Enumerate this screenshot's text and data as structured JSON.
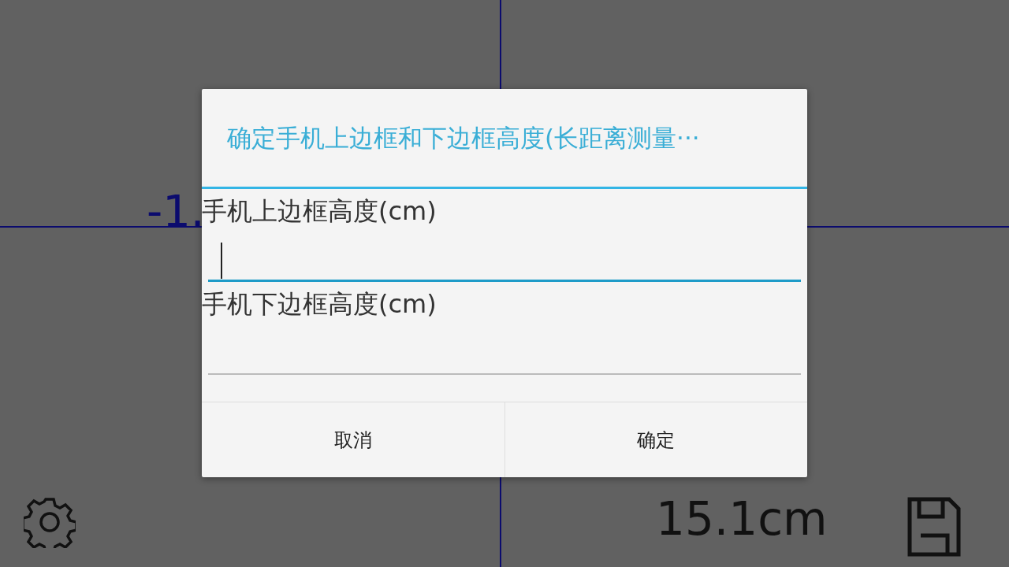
{
  "readings": [
    {
      "kind": "left",
      "text": "-1."
    },
    {
      "kind": "bottom",
      "text": "15.1cm"
    }
  ],
  "dialog": {
    "title": "确定手机上边框和下边框高度(长距离测量···",
    "fields": [
      {
        "label": "手机上边框高度(cm)",
        "focused": true
      },
      {
        "label": "手机下边框高度(cm)",
        "focused": false
      }
    ],
    "buttons": [
      "取消",
      "确定"
    ]
  }
}
